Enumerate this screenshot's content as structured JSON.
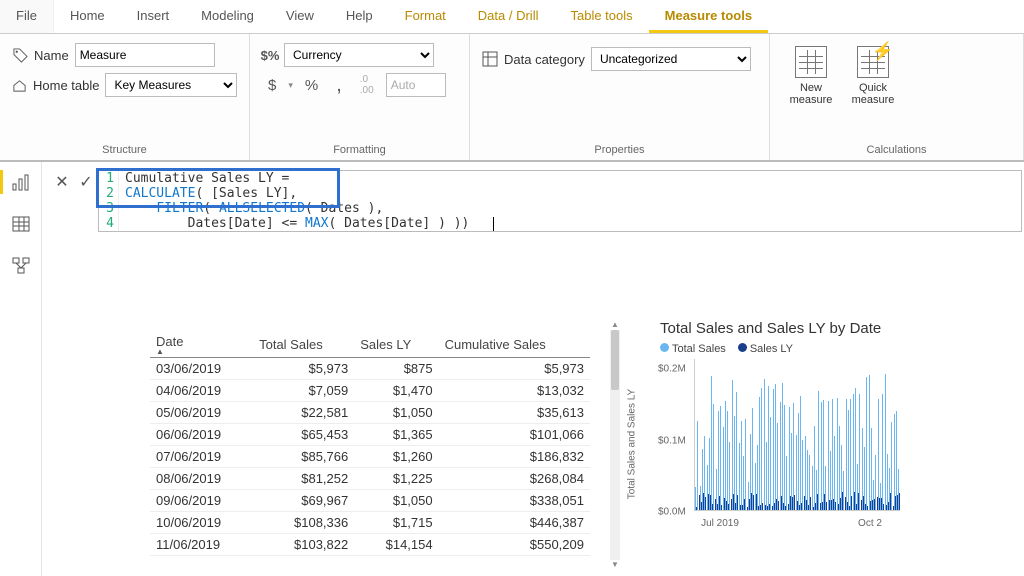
{
  "menubar": {
    "tabs": [
      "File",
      "Home",
      "Insert",
      "Modeling",
      "View",
      "Help",
      "Format",
      "Data / Drill",
      "Table tools",
      "Measure tools"
    ],
    "context_start": 6,
    "active": 9
  },
  "ribbon": {
    "structure": {
      "name_label": "Name",
      "name_value": "Measure",
      "home_table_label": "Home table",
      "home_table_value": "Key Measures",
      "group_label": "Structure"
    },
    "formatting": {
      "format_value": "Currency",
      "decimals_value": "Auto",
      "symbols": {
        "dollar": "$",
        "percent": "%",
        "comma": ",",
        "decimals_icon": ".00→.0"
      },
      "group_label": "Formatting"
    },
    "properties": {
      "data_category_label": "Data category",
      "data_category_value": "Uncategorized",
      "group_label": "Properties"
    },
    "calculations": {
      "new_measure": "New measure",
      "quick_measure": "Quick measure",
      "group_label": "Calculations"
    }
  },
  "formula": {
    "lines": [
      {
        "n": "1",
        "plain": "Cumulative Sales LY ="
      },
      {
        "n": "2",
        "fn": "CALCULATE",
        "rest": "( [Sales LY],"
      },
      {
        "n": "3",
        "indent": "    ",
        "fn": "FILTER",
        "mid": "( ",
        "fn2": "ALLSELECTED",
        "rest2": "( Dates ),"
      },
      {
        "n": "4",
        "indent": "        ",
        "pre": "Dates[Date] <= ",
        "fn": "MAX",
        "rest": "( Dates[Date] ) ))"
      }
    ]
  },
  "table": {
    "headers": [
      "Date",
      "Total Sales",
      "Sales LY",
      "Cumulative Sales"
    ],
    "rows": [
      [
        "03/06/2019",
        "$5,973",
        "$875",
        "$5,973"
      ],
      [
        "04/06/2019",
        "$7,059",
        "$1,470",
        "$13,032"
      ],
      [
        "05/06/2019",
        "$22,581",
        "$1,050",
        "$35,613"
      ],
      [
        "06/06/2019",
        "$65,453",
        "$1,365",
        "$101,066"
      ],
      [
        "07/06/2019",
        "$85,766",
        "$1,260",
        "$186,832"
      ],
      [
        "08/06/2019",
        "$81,252",
        "$1,225",
        "$268,084"
      ],
      [
        "09/06/2019",
        "$69,967",
        "$1,050",
        "$338,051"
      ],
      [
        "10/06/2019",
        "$108,336",
        "$1,715",
        "$446,387"
      ],
      [
        "11/06/2019",
        "$103,822",
        "$14,154",
        "$550,209"
      ]
    ]
  },
  "chart_data": {
    "type": "bar",
    "title": "Total Sales and Sales LY by Date",
    "ylabel": "Total Sales and Sales LY",
    "yticks": [
      "$0.2M",
      "$0.1M",
      "$0.0M"
    ],
    "ylim": [
      0,
      200000
    ],
    "xticks": [
      "Jul 2019",
      "Oct 2"
    ],
    "series": [
      {
        "name": "Total Sales",
        "color": "#6bb6f0"
      },
      {
        "name": "Sales LY",
        "color": "#1a3e8c"
      }
    ],
    "note": "Daily bars ~Jun–Oct 2019; Total Sales ranges roughly $0–$0.18M, Sales LY clustered near $0–$0.02M"
  }
}
